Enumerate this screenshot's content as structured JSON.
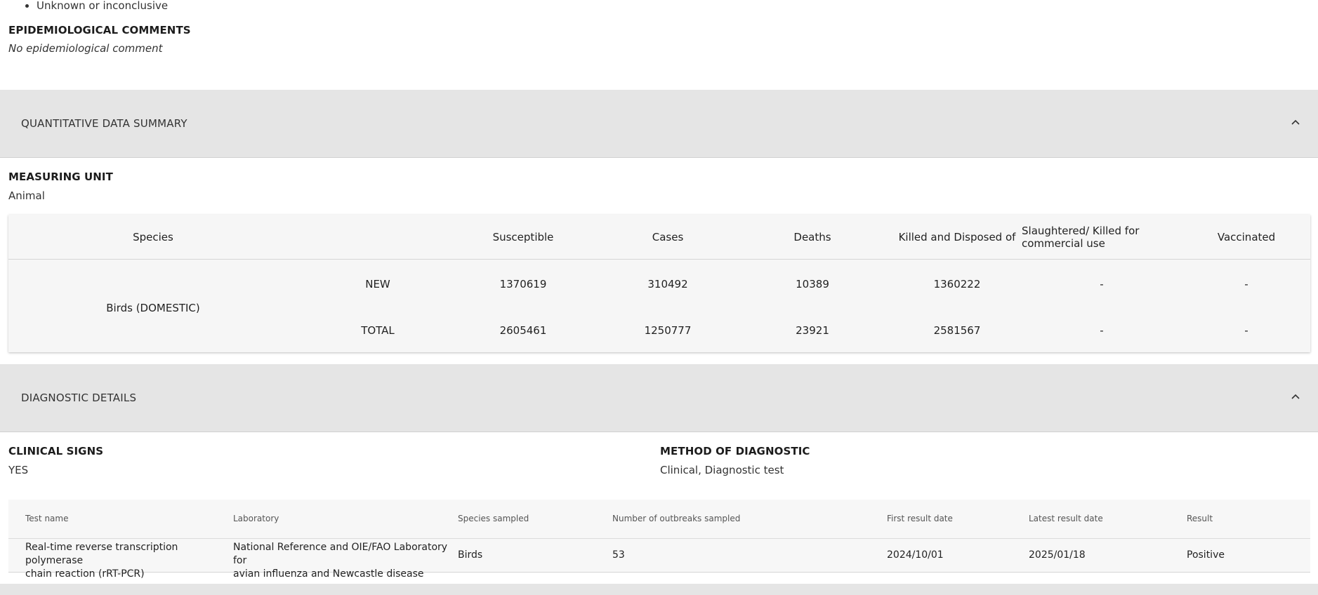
{
  "top_list": {
    "item": "Unknown or inconclusive"
  },
  "epidemiological": {
    "title": "EPIDEMIOLOGICAL COMMENTS",
    "value": "No epidemiological comment"
  },
  "quantitative_panel": {
    "title": "QUANTITATIVE DATA SUMMARY",
    "chevron": "chevron-up-icon"
  },
  "measuring_unit": {
    "title": "MEASURING UNIT",
    "value": "Animal"
  },
  "quantitative_table": {
    "headers": {
      "species": "Species",
      "susceptible": "Susceptible",
      "cases": "Cases",
      "deaths": "Deaths",
      "killed": "Killed and Disposed of",
      "slaughtered_line1": "Slaughtered/ Killed for",
      "slaughtered_line2": "commercial use",
      "vaccinated": "Vaccinated"
    },
    "species_name": "Birds (DOMESTIC)",
    "rows": [
      {
        "label": "NEW",
        "susceptible": "1370619",
        "cases": "310492",
        "deaths": "10389",
        "killed": "1360222",
        "slaughtered": "-",
        "vaccinated": "-"
      },
      {
        "label": "TOTAL",
        "susceptible": "2605461",
        "cases": "1250777",
        "deaths": "23921",
        "killed": "2581567",
        "slaughtered": "-",
        "vaccinated": "-"
      }
    ]
  },
  "diagnostic_panel": {
    "title": "DIAGNOSTIC DETAILS",
    "chevron": "chevron-up-icon"
  },
  "clinical_signs": {
    "title": "CLINICAL SIGNS",
    "value": "YES"
  },
  "method": {
    "title": "METHOD OF DIAGNOSTIC",
    "value": "Clinical, Diagnostic test"
  },
  "diagnostic_table": {
    "headers": {
      "test_name": "Test name",
      "laboratory": "Laboratory",
      "species_sampled": "Species sampled",
      "outbreaks": "Number of outbreaks sampled",
      "first_date": "First result date",
      "latest_date": "Latest result date",
      "result": "Result"
    },
    "row": {
      "test_name_line1": "Real-time reverse transcription polymerase",
      "test_name_line2": "chain reaction (rRT-PCR)",
      "laboratory_line1": "National Reference and OIE/FAO Laboratory for",
      "laboratory_line2": "avian influenza and Newcastle disease",
      "species_sampled": "Birds",
      "outbreaks": "53",
      "first_date": "2024/10/01",
      "latest_date": "2025/01/18",
      "result": "Positive"
    }
  }
}
